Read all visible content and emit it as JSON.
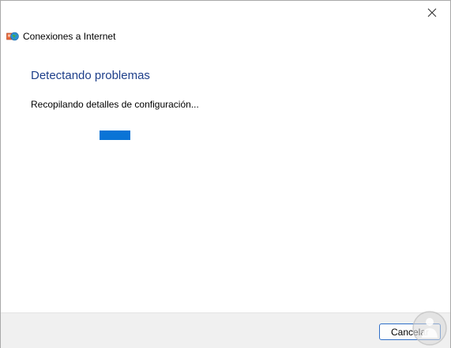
{
  "window": {
    "app_title": "Conexiones a Internet",
    "close_icon": "close-icon",
    "app_icon": "network-globe-icon"
  },
  "main": {
    "heading": "Detectando problemas",
    "status": "Recopilando detalles de configuración...",
    "progress_state": "indeterminate",
    "progress_color": "#0a74d6"
  },
  "footer": {
    "cancel_label": "Cancelar"
  },
  "colors": {
    "heading": "#1e3f8a",
    "accent": "#0a74d6",
    "footer_bg": "#f0f0f0"
  }
}
